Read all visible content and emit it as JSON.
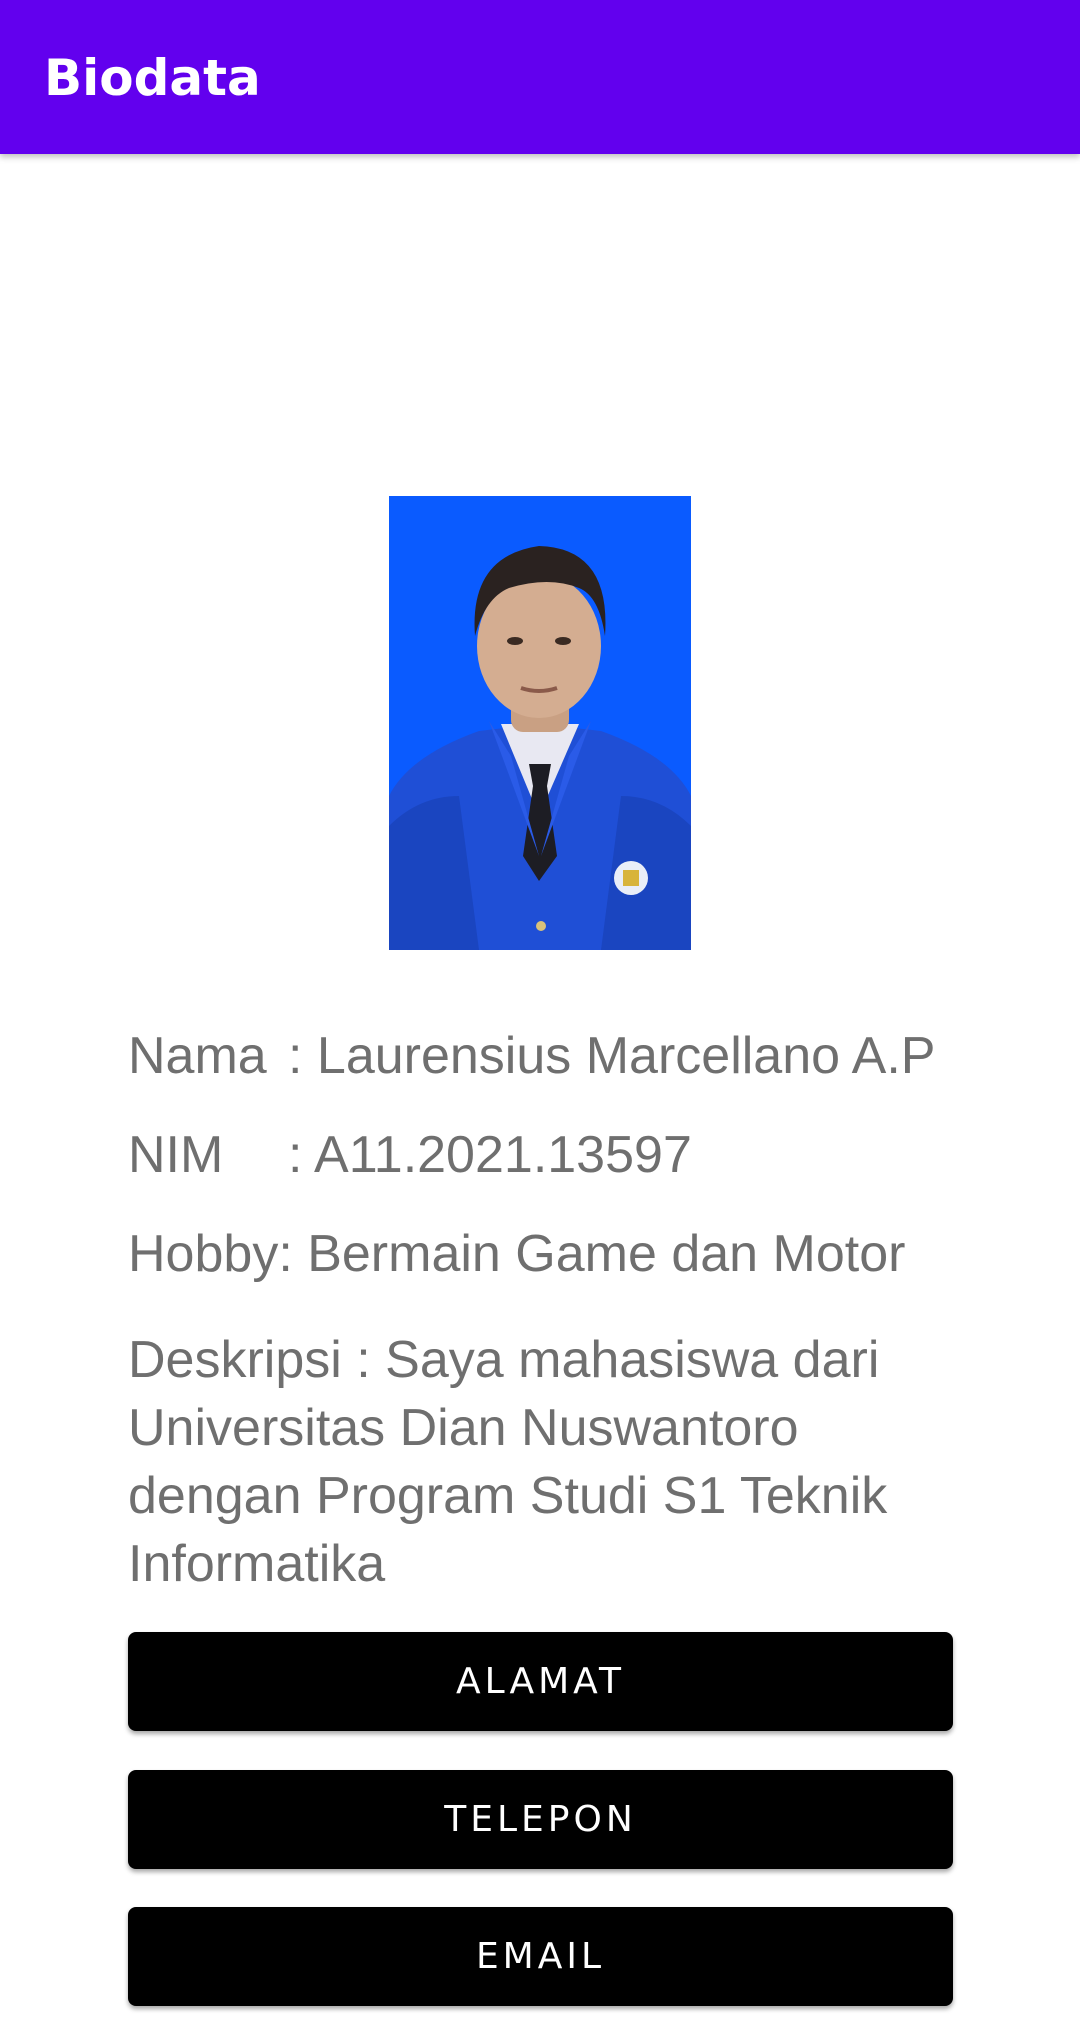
{
  "app_bar": {
    "title": "Biodata",
    "color": "#6200EE"
  },
  "profile": {
    "photo_background": "#0A5BFF",
    "fields": {
      "nama_label": "Nama",
      "nama_value": ": Laurensius Marcellano A.P",
      "nim_label": "NIM",
      "nim_value": ": A11.2021.13597",
      "hobby_label": "Hobby",
      "hobby_value": ": Bermain Game dan Motor"
    },
    "description": "Deskripsi : Saya mahasiswa dari Universitas Dian Nuswantoro dengan Program Studi S1 Teknik Informatika"
  },
  "buttons": {
    "alamat": "ALAMAT",
    "telepon": "TELEPON",
    "email": "EMAIL"
  }
}
